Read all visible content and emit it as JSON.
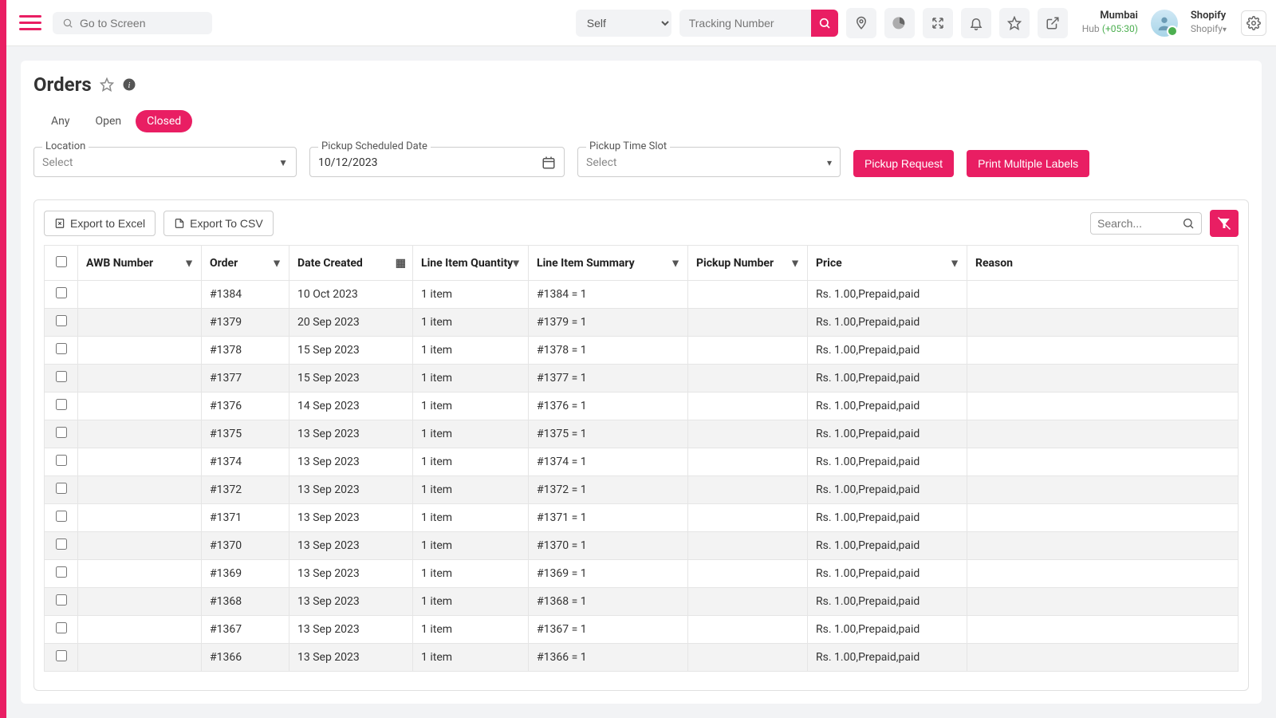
{
  "header": {
    "search_placeholder": "Go to Screen",
    "self_select": "Self",
    "tracking_placeholder": "Tracking Number",
    "hub": {
      "city": "Mumbai",
      "label": "Hub",
      "tz": "(+05:30)"
    },
    "user": {
      "name": "Shopify",
      "platform": "Shopify"
    }
  },
  "page": {
    "title": "Orders",
    "tabs": {
      "any": "Any",
      "open": "Open",
      "closed": "Closed"
    },
    "fields": {
      "location_label": "Location",
      "location_value": "Select",
      "date_label": "Pickup Scheduled Date",
      "date_value": "10/12/2023",
      "slot_label": "Pickup Time Slot",
      "slot_value": "Select"
    },
    "buttons": {
      "pickup": "Pickup Request",
      "labels": "Print Multiple Labels"
    }
  },
  "table": {
    "export_excel": "Export to Excel",
    "export_csv": "Export To CSV",
    "search_placeholder": "Search...",
    "columns": {
      "awb": "AWB Number",
      "order": "Order",
      "date": "Date Created",
      "qty": "Line Item Quantity",
      "summary": "Line Item Summary",
      "pickup": "Pickup Number",
      "price": "Price",
      "reason": "Reason"
    },
    "rows": [
      {
        "order": "#1384",
        "date": "10 Oct 2023",
        "qty": "1 item",
        "summary": "#1384 = 1",
        "price": "Rs. 1.00,Prepaid,paid"
      },
      {
        "order": "#1379",
        "date": "20 Sep 2023",
        "qty": "1 item",
        "summary": "#1379 = 1",
        "price": "Rs. 1.00,Prepaid,paid"
      },
      {
        "order": "#1378",
        "date": "15 Sep 2023",
        "qty": "1 item",
        "summary": "#1378 = 1",
        "price": "Rs. 1.00,Prepaid,paid"
      },
      {
        "order": "#1377",
        "date": "15 Sep 2023",
        "qty": "1 item",
        "summary": "#1377 = 1",
        "price": "Rs. 1.00,Prepaid,paid"
      },
      {
        "order": "#1376",
        "date": "14 Sep 2023",
        "qty": "1 item",
        "summary": "#1376 = 1",
        "price": "Rs. 1.00,Prepaid,paid"
      },
      {
        "order": "#1375",
        "date": "13 Sep 2023",
        "qty": "1 item",
        "summary": "#1375 = 1",
        "price": "Rs. 1.00,Prepaid,paid"
      },
      {
        "order": "#1374",
        "date": "13 Sep 2023",
        "qty": "1 item",
        "summary": "#1374 = 1",
        "price": "Rs. 1.00,Prepaid,paid"
      },
      {
        "order": "#1372",
        "date": "13 Sep 2023",
        "qty": "1 item",
        "summary": "#1372 = 1",
        "price": "Rs. 1.00,Prepaid,paid"
      },
      {
        "order": "#1371",
        "date": "13 Sep 2023",
        "qty": "1 item",
        "summary": "#1371 = 1",
        "price": "Rs. 1.00,Prepaid,paid"
      },
      {
        "order": "#1370",
        "date": "13 Sep 2023",
        "qty": "1 item",
        "summary": "#1370 = 1",
        "price": "Rs. 1.00,Prepaid,paid"
      },
      {
        "order": "#1369",
        "date": "13 Sep 2023",
        "qty": "1 item",
        "summary": "#1369 = 1",
        "price": "Rs. 1.00,Prepaid,paid"
      },
      {
        "order": "#1368",
        "date": "13 Sep 2023",
        "qty": "1 item",
        "summary": "#1368 = 1",
        "price": "Rs. 1.00,Prepaid,paid"
      },
      {
        "order": "#1367",
        "date": "13 Sep 2023",
        "qty": "1 item",
        "summary": "#1367 = 1",
        "price": "Rs. 1.00,Prepaid,paid"
      },
      {
        "order": "#1366",
        "date": "13 Sep 2023",
        "qty": "1 item",
        "summary": "#1366 = 1",
        "price": "Rs. 1.00,Prepaid,paid"
      }
    ]
  }
}
